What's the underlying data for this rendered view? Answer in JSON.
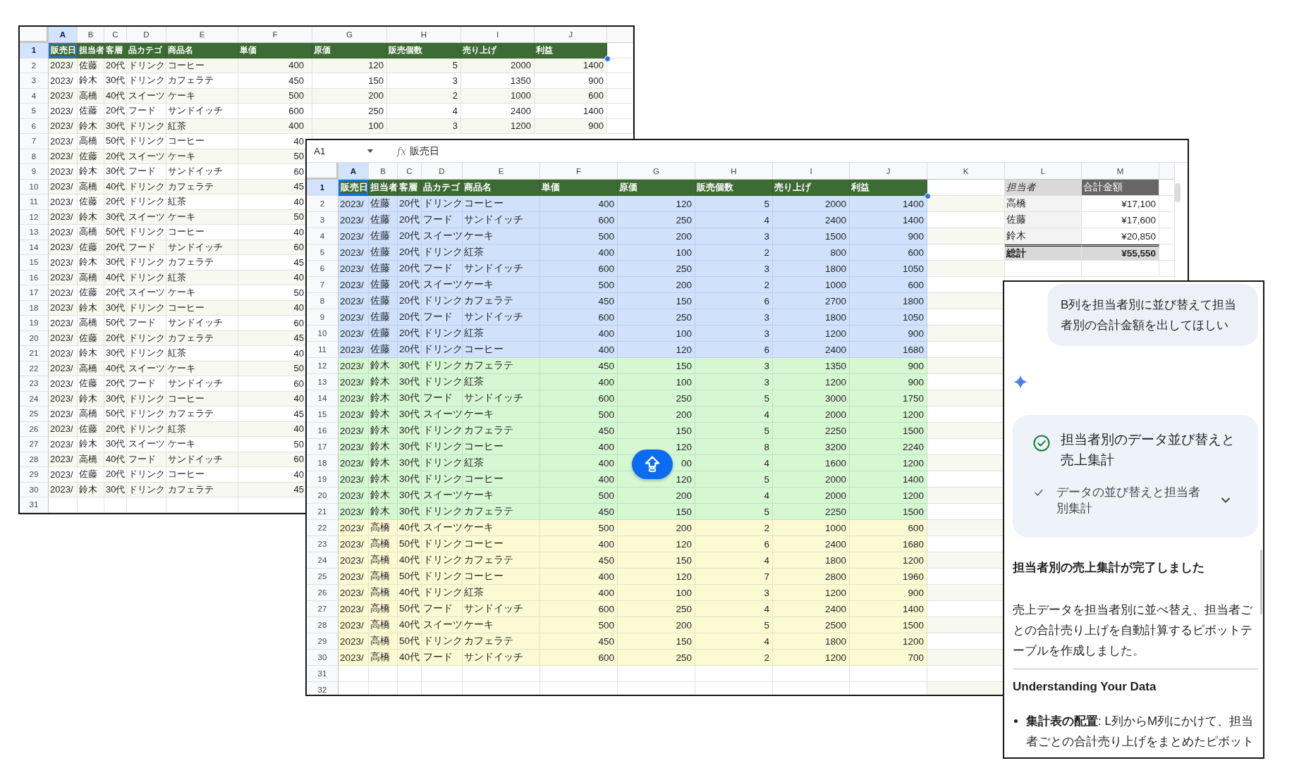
{
  "back_sheet": {
    "column_headers": [
      {
        "label": "A",
        "selected": true
      },
      {
        "label": "B",
        "selected": false
      },
      {
        "label": "C",
        "selected": false
      },
      {
        "label": "D",
        "selected": false
      },
      {
        "label": "E",
        "selected": false
      },
      {
        "label": "F",
        "selected": false
      },
      {
        "label": "G",
        "selected": false
      },
      {
        "label": "H",
        "selected": false
      },
      {
        "label": "I",
        "selected": false
      },
      {
        "label": "J",
        "selected": false
      }
    ],
    "rows": [
      {
        "number": "1",
        "selected": true,
        "kind": "header",
        "cells": [
          "販売日",
          "担当者",
          "客層",
          "品カテゴ",
          "商品名",
          "単価",
          "原価",
          "販売個数",
          "売り上げ",
          "利益"
        ]
      },
      {
        "number": "2",
        "selected": false,
        "kind": "data",
        "cells": [
          "2023/",
          "佐藤",
          "20代",
          "ドリンク",
          "コーヒー",
          "400",
          "120",
          "5",
          "2000",
          "1400"
        ]
      },
      {
        "number": "3",
        "selected": false,
        "kind": "data",
        "cells": [
          "2023/",
          "鈴木",
          "30代",
          "ドリンク",
          "カフェラテ",
          "450",
          "150",
          "3",
          "1350",
          "900"
        ]
      },
      {
        "number": "4",
        "selected": false,
        "kind": "data",
        "cells": [
          "2023/",
          "高橋",
          "40代",
          "スイーツ",
          "ケーキ",
          "500",
          "200",
          "2",
          "1000",
          "600"
        ]
      },
      {
        "number": "5",
        "selected": false,
        "kind": "data",
        "cells": [
          "2023/",
          "佐藤",
          "20代",
          "フード",
          "サンドイッチ",
          "600",
          "250",
          "4",
          "2400",
          "1400"
        ]
      },
      {
        "number": "6",
        "selected": false,
        "kind": "data",
        "cells": [
          "2023/",
          "鈴木",
          "30代",
          "ドリンク",
          "紅茶",
          "400",
          "100",
          "3",
          "1200",
          "900"
        ]
      },
      {
        "number": "7",
        "selected": false,
        "kind": "data",
        "cells": [
          "2023/",
          "高橋",
          "50代",
          "ドリンク",
          "コーヒー",
          "40"
        ]
      },
      {
        "number": "8",
        "selected": false,
        "kind": "data",
        "cells": [
          "2023/",
          "佐藤",
          "20代",
          "スイーツ",
          "ケーキ",
          "50"
        ]
      },
      {
        "number": "9",
        "selected": false,
        "kind": "data",
        "cells": [
          "2023/",
          "鈴木",
          "30代",
          "フード",
          "サンドイッチ",
          "60"
        ]
      },
      {
        "number": "10",
        "selected": false,
        "kind": "data",
        "cells": [
          "2023/",
          "高橋",
          "40代",
          "ドリンク",
          "カフェラテ",
          "45"
        ]
      },
      {
        "number": "11",
        "selected": false,
        "kind": "data",
        "cells": [
          "2023/",
          "佐藤",
          "20代",
          "ドリンク",
          "紅茶",
          "40"
        ]
      },
      {
        "number": "12",
        "selected": false,
        "kind": "data",
        "cells": [
          "2023/",
          "鈴木",
          "30代",
          "スイーツ",
          "ケーキ",
          "50"
        ]
      },
      {
        "number": "13",
        "selected": false,
        "kind": "data",
        "cells": [
          "2023/",
          "高橋",
          "50代",
          "ドリンク",
          "コーヒー",
          "40"
        ]
      },
      {
        "number": "14",
        "selected": false,
        "kind": "data",
        "cells": [
          "2023/",
          "佐藤",
          "20代",
          "フード",
          "サンドイッチ",
          "60"
        ]
      },
      {
        "number": "15",
        "selected": false,
        "kind": "data",
        "cells": [
          "2023/",
          "鈴木",
          "30代",
          "ドリンク",
          "カフェラテ",
          "45"
        ]
      },
      {
        "number": "16",
        "selected": false,
        "kind": "data",
        "cells": [
          "2023/",
          "高橋",
          "40代",
          "ドリンク",
          "紅茶",
          "40"
        ]
      },
      {
        "number": "17",
        "selected": false,
        "kind": "data",
        "cells": [
          "2023/",
          "佐藤",
          "20代",
          "スイーツ",
          "ケーキ",
          "50"
        ]
      },
      {
        "number": "18",
        "selected": false,
        "kind": "data",
        "cells": [
          "2023/",
          "鈴木",
          "30代",
          "ドリンク",
          "コーヒー",
          "40"
        ]
      },
      {
        "number": "19",
        "selected": false,
        "kind": "data",
        "cells": [
          "2023/",
          "高橋",
          "50代",
          "フード",
          "サンドイッチ",
          "60"
        ]
      },
      {
        "number": "20",
        "selected": false,
        "kind": "data",
        "cells": [
          "2023/",
          "佐藤",
          "20代",
          "ドリンク",
          "カフェラテ",
          "45"
        ]
      },
      {
        "number": "21",
        "selected": false,
        "kind": "data",
        "cells": [
          "2023/",
          "鈴木",
          "30代",
          "ドリンク",
          "紅茶",
          "40"
        ]
      },
      {
        "number": "22",
        "selected": false,
        "kind": "data",
        "cells": [
          "2023/",
          "高橋",
          "40代",
          "スイーツ",
          "ケーキ",
          "50"
        ]
      },
      {
        "number": "23",
        "selected": false,
        "kind": "data",
        "cells": [
          "2023/",
          "佐藤",
          "20代",
          "フード",
          "サンドイッチ",
          "60"
        ]
      },
      {
        "number": "24",
        "selected": false,
        "kind": "data",
        "cells": [
          "2023/",
          "鈴木",
          "30代",
          "ドリンク",
          "コーヒー",
          "40"
        ]
      },
      {
        "number": "25",
        "selected": false,
        "kind": "data",
        "cells": [
          "2023/",
          "高橋",
          "50代",
          "ドリンク",
          "カフェラテ",
          "45"
        ]
      },
      {
        "number": "26",
        "selected": false,
        "kind": "data",
        "cells": [
          "2023/",
          "佐藤",
          "20代",
          "ドリンク",
          "紅茶",
          "40"
        ]
      },
      {
        "number": "27",
        "selected": false,
        "kind": "data",
        "cells": [
          "2023/",
          "鈴木",
          "30代",
          "スイーツ",
          "ケーキ",
          "50"
        ]
      },
      {
        "number": "28",
        "selected": false,
        "kind": "data",
        "cells": [
          "2023/",
          "高橋",
          "40代",
          "フード",
          "サンドイッチ",
          "60"
        ]
      },
      {
        "number": "29",
        "selected": false,
        "kind": "data",
        "cells": [
          "2023/",
          "佐藤",
          "20代",
          "ドリンク",
          "コーヒー",
          "40"
        ]
      },
      {
        "number": "30",
        "selected": false,
        "kind": "data",
        "cells": [
          "2023/",
          "鈴木",
          "30代",
          "ドリンク",
          "カフェラテ",
          "45"
        ]
      },
      {
        "number": "31",
        "selected": false,
        "kind": "data"
      }
    ]
  },
  "front_sheet": {
    "name_box": "A1",
    "function_label": "fx",
    "formula": "販売日",
    "column_headers": [
      {
        "label": "A",
        "selected": true
      },
      {
        "label": "B",
        "selected": false
      },
      {
        "label": "C",
        "selected": false
      },
      {
        "label": "D",
        "selected": false
      },
      {
        "label": "E",
        "selected": false
      },
      {
        "label": "F",
        "selected": false
      },
      {
        "label": "G",
        "selected": false
      },
      {
        "label": "H",
        "selected": false
      },
      {
        "label": "I",
        "selected": false
      },
      {
        "label": "J",
        "selected": false
      },
      {
        "label": "K",
        "selected": false
      },
      {
        "label": "L",
        "selected": false
      },
      {
        "label": "M",
        "selected": false
      }
    ],
    "rows": [
      {
        "number": "1",
        "selected": true,
        "kind": "header",
        "cells": [
          "販売日",
          "担当者",
          "客層",
          "品カテゴ",
          "商品名",
          "単価",
          "原価",
          "販売個数",
          "売り上げ",
          "利益"
        ]
      },
      {
        "number": "2",
        "selected": false,
        "kind": "data",
        "color": "#cfe1fb",
        "cells": [
          "2023/",
          "佐藤",
          "20代",
          "ドリンク",
          "コーヒー",
          "400",
          "120",
          "5",
          "2000",
          "1400"
        ]
      },
      {
        "number": "3",
        "selected": false,
        "kind": "data",
        "color": "#cfe1fb",
        "cells": [
          "2023/",
          "佐藤",
          "20代",
          "フード",
          "サンドイッチ",
          "600",
          "250",
          "4",
          "2400",
          "1400"
        ]
      },
      {
        "number": "4",
        "selected": false,
        "kind": "data",
        "color": "#cfe1fb",
        "cells": [
          "2023/",
          "佐藤",
          "20代",
          "スイーツ",
          "ケーキ",
          "500",
          "200",
          "3",
          "1500",
          "900"
        ]
      },
      {
        "number": "5",
        "selected": false,
        "kind": "data",
        "color": "#cfe1fb",
        "cells": [
          "2023/",
          "佐藤",
          "20代",
          "ドリンク",
          "紅茶",
          "400",
          "100",
          "2",
          "800",
          "600"
        ]
      },
      {
        "number": "6",
        "selected": false,
        "kind": "data",
        "color": "#cfe1fb",
        "cells": [
          "2023/",
          "佐藤",
          "20代",
          "フード",
          "サンドイッチ",
          "600",
          "250",
          "3",
          "1800",
          "1050"
        ]
      },
      {
        "number": "7",
        "selected": false,
        "kind": "data",
        "color": "#cfe1fb",
        "cells": [
          "2023/",
          "佐藤",
          "20代",
          "スイーツ",
          "ケーキ",
          "500",
          "200",
          "2",
          "1000",
          "600"
        ]
      },
      {
        "number": "8",
        "selected": false,
        "kind": "data",
        "color": "#cfe1fb",
        "cells": [
          "2023/",
          "佐藤",
          "20代",
          "ドリンク",
          "カフェラテ",
          "450",
          "150",
          "6",
          "2700",
          "1800"
        ]
      },
      {
        "number": "9",
        "selected": false,
        "kind": "data",
        "color": "#cfe1fb",
        "cells": [
          "2023/",
          "佐藤",
          "20代",
          "フード",
          "サンドイッチ",
          "600",
          "250",
          "3",
          "1800",
          "1050"
        ]
      },
      {
        "number": "10",
        "selected": false,
        "kind": "data",
        "color": "#cfe1fb",
        "cells": [
          "2023/",
          "佐藤",
          "20代",
          "ドリンク",
          "紅茶",
          "400",
          "100",
          "3",
          "1200",
          "900"
        ]
      },
      {
        "number": "11",
        "selected": false,
        "kind": "data",
        "color": "#cfe1fb",
        "cells": [
          "2023/",
          "佐藤",
          "20代",
          "ドリンク",
          "コーヒー",
          "400",
          "120",
          "6",
          "2400",
          "1680"
        ]
      },
      {
        "number": "12",
        "selected": false,
        "kind": "data",
        "color": "#d5f7d1",
        "cells": [
          "2023/",
          "鈴木",
          "30代",
          "ドリンク",
          "カフェラテ",
          "450",
          "150",
          "3",
          "1350",
          "900"
        ]
      },
      {
        "number": "13",
        "selected": false,
        "kind": "data",
        "color": "#d5f7d1",
        "cells": [
          "2023/",
          "鈴木",
          "30代",
          "ドリンク",
          "紅茶",
          "400",
          "100",
          "3",
          "1200",
          "900"
        ]
      },
      {
        "number": "14",
        "selected": false,
        "kind": "data",
        "color": "#d5f7d1",
        "cells": [
          "2023/",
          "鈴木",
          "30代",
          "フード",
          "サンドイッチ",
          "600",
          "250",
          "5",
          "3000",
          "1750"
        ]
      },
      {
        "number": "15",
        "selected": false,
        "kind": "data",
        "color": "#d5f7d1",
        "cells": [
          "2023/",
          "鈴木",
          "30代",
          "スイーツ",
          "ケーキ",
          "500",
          "200",
          "4",
          "2000",
          "1200"
        ]
      },
      {
        "number": "16",
        "selected": false,
        "kind": "data",
        "color": "#d5f7d1",
        "cells": [
          "2023/",
          "鈴木",
          "30代",
          "ドリンク",
          "カフェラテ",
          "450",
          "150",
          "5",
          "2250",
          "1500"
        ]
      },
      {
        "number": "17",
        "selected": false,
        "kind": "data",
        "color": "#d5f7d1",
        "cells": [
          "2023/",
          "鈴木",
          "30代",
          "ドリンク",
          "コーヒー",
          "400",
          "120",
          "8",
          "3200",
          "2240"
        ]
      },
      {
        "number": "18",
        "selected": false,
        "kind": "data",
        "color": "#d5f7d1",
        "cells": [
          "2023/",
          "鈴木",
          "30代",
          "ドリンク",
          "紅茶",
          "400",
          "00",
          "4",
          "1600",
          "1200"
        ]
      },
      {
        "number": "19",
        "selected": false,
        "kind": "data",
        "color": "#d5f7d1",
        "cells": [
          "2023/",
          "鈴木",
          "30代",
          "ドリンク",
          "コーヒー",
          "400",
          "120",
          "5",
          "2000",
          "1400"
        ]
      },
      {
        "number": "20",
        "selected": false,
        "kind": "data",
        "color": "#d5f7d1",
        "cells": [
          "2023/",
          "鈴木",
          "30代",
          "スイーツ",
          "ケーキ",
          "500",
          "200",
          "4",
          "2000",
          "1200"
        ]
      },
      {
        "number": "21",
        "selected": false,
        "kind": "data",
        "color": "#d5f7d1",
        "cells": [
          "2023/",
          "鈴木",
          "30代",
          "ドリンク",
          "カフェラテ",
          "450",
          "150",
          "5",
          "2250",
          "1500"
        ]
      },
      {
        "number": "22",
        "selected": false,
        "kind": "data",
        "color": "#fcfad2",
        "cells": [
          "2023/",
          "高橋",
          "40代",
          "スイーツ",
          "ケーキ",
          "500",
          "200",
          "2",
          "1000",
          "600"
        ]
      },
      {
        "number": "23",
        "selected": false,
        "kind": "data",
        "color": "#fcfad2",
        "cells": [
          "2023/",
          "高橋",
          "50代",
          "ドリンク",
          "コーヒー",
          "400",
          "120",
          "6",
          "2400",
          "1680"
        ]
      },
      {
        "number": "24",
        "selected": false,
        "kind": "data",
        "color": "#fcfad2",
        "cells": [
          "2023/",
          "高橋",
          "40代",
          "ドリンク",
          "カフェラテ",
          "450",
          "150",
          "4",
          "1800",
          "1200"
        ]
      },
      {
        "number": "25",
        "selected": false,
        "kind": "data",
        "color": "#fcfad2",
        "cells": [
          "2023/",
          "高橋",
          "50代",
          "ドリンク",
          "コーヒー",
          "400",
          "120",
          "7",
          "2800",
          "1960"
        ]
      },
      {
        "number": "26",
        "selected": false,
        "kind": "data",
        "color": "#fcfad2",
        "cells": [
          "2023/",
          "高橋",
          "40代",
          "ドリンク",
          "紅茶",
          "400",
          "100",
          "3",
          "1200",
          "900"
        ]
      },
      {
        "number": "27",
        "selected": false,
        "kind": "data",
        "color": "#fcfad2",
        "cells": [
          "2023/",
          "高橋",
          "50代",
          "フード",
          "サンドイッチ",
          "600",
          "250",
          "4",
          "2400",
          "1400"
        ]
      },
      {
        "number": "28",
        "selected": false,
        "kind": "data",
        "color": "#fcfad2",
        "cells": [
          "2023/",
          "高橋",
          "40代",
          "スイーツ",
          "ケーキ",
          "500",
          "200",
          "5",
          "2500",
          "1500"
        ]
      },
      {
        "number": "29",
        "selected": false,
        "kind": "data",
        "color": "#fcfad2",
        "cells": [
          "2023/",
          "高橋",
          "50代",
          "ドリンク",
          "カフェラテ",
          "450",
          "150",
          "4",
          "1800",
          "1200"
        ]
      },
      {
        "number": "30",
        "selected": false,
        "kind": "data",
        "color": "#fcfad2",
        "cells": [
          "2023/",
          "高橋",
          "40代",
          "フード",
          "サンドイッチ",
          "600",
          "250",
          "2",
          "1200",
          "700"
        ]
      },
      {
        "number": "31",
        "selected": false,
        "kind": "data"
      },
      {
        "number": "32",
        "selected": false,
        "kind": "data"
      }
    ],
    "summary_table": {
      "columns": [
        "担当者",
        "合計金額"
      ],
      "rows": [
        {
          "name": "高橋",
          "total": "¥17,100"
        },
        {
          "name": "佐藤",
          "total": "¥17,600"
        },
        {
          "name": "鈴木",
          "total": "¥20,850"
        }
      ],
      "grand_total": {
        "label": "総計",
        "total": "¥55,550"
      }
    }
  },
  "assistant_panel": {
    "user_message": "B列を担当者別に並び替えて担当者別の合計金額を出してほしい",
    "task": {
      "title": "担当者別のデータ並び替えと売上集計",
      "done": true,
      "expanded": false,
      "steps": [
        {
          "label": "データの並び替えと担当者別集計",
          "done": true
        }
      ]
    },
    "heading": "担当者別の売上集計が完了しました",
    "summary": "売上データを担当者別に並べ替え、担当者ごとの合計売り上げを自動計算するピボットテーブルを作成しました。",
    "section_title": "Understanding Your Data",
    "bullets": [
      "**集計表の配置**: L列からM列にかけて、担当者ごとの合計売り上げをまとめたピボット"
    ]
  }
}
